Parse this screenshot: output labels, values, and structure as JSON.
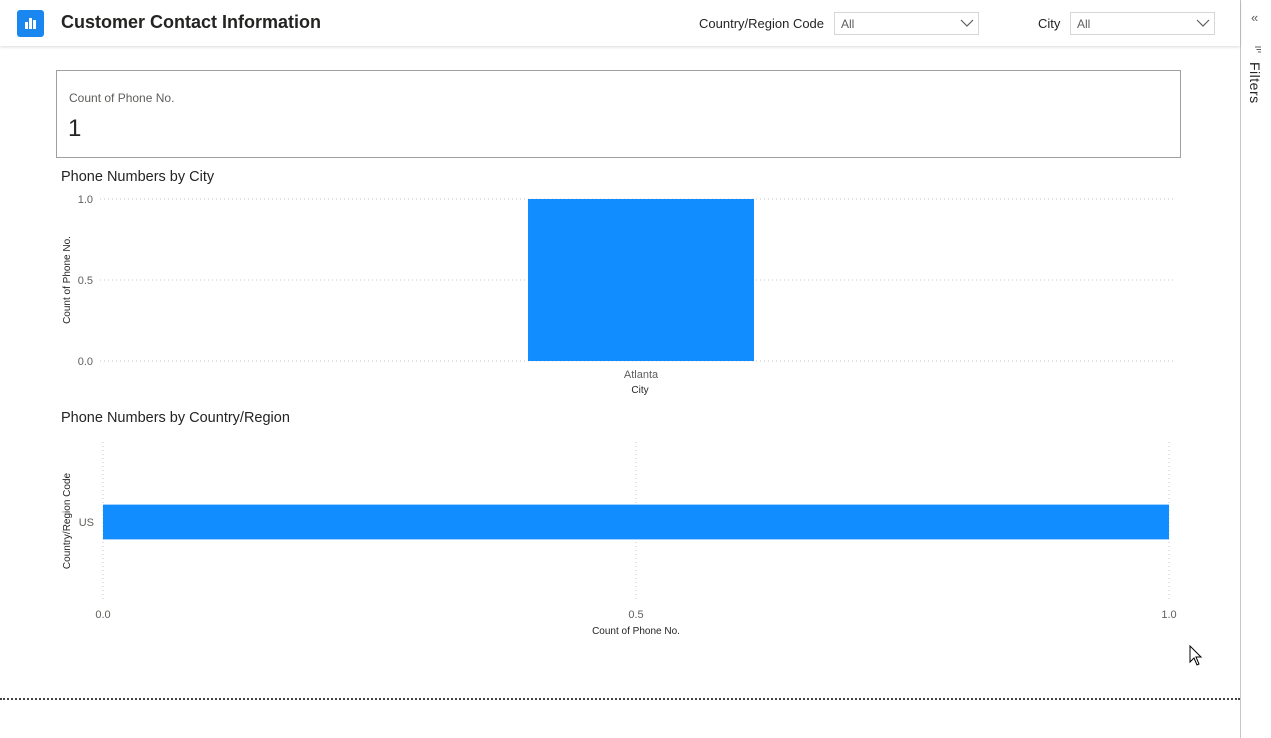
{
  "header": {
    "title": "Customer Contact Information",
    "slicers": {
      "country": {
        "label": "Country/Region Code",
        "value": "All"
      },
      "city": {
        "label": "City",
        "value": "All"
      }
    }
  },
  "filters_pane": {
    "label": "Filters",
    "collapse_glyph": "«"
  },
  "card": {
    "label": "Count of Phone No.",
    "value": "1"
  },
  "city_chart": {
    "title": "Phone Numbers by City"
  },
  "country_chart": {
    "title": "Phone Numbers by Country/Region"
  },
  "colors": {
    "accent": "#1a86f0",
    "bar": "#118dff"
  },
  "chart_data": [
    {
      "type": "bar",
      "orientation": "vertical",
      "title": "Phone Numbers by City",
      "categories": [
        "Atlanta"
      ],
      "values": [
        1
      ],
      "xlabel": "City",
      "ylabel": "Count of Phone No.",
      "ylim": [
        0,
        1
      ],
      "yticks": [
        "0.0",
        "0.5",
        "1.0"
      ],
      "grid": true
    },
    {
      "type": "bar",
      "orientation": "horizontal",
      "title": "Phone Numbers by Country/Region",
      "categories": [
        "US"
      ],
      "values": [
        1
      ],
      "xlabel": "Count of Phone No.",
      "ylabel": "Country/Region Code",
      "xlim": [
        0,
        1
      ],
      "xticks": [
        "0.0",
        "0.5",
        "1.0"
      ],
      "grid": true
    }
  ]
}
